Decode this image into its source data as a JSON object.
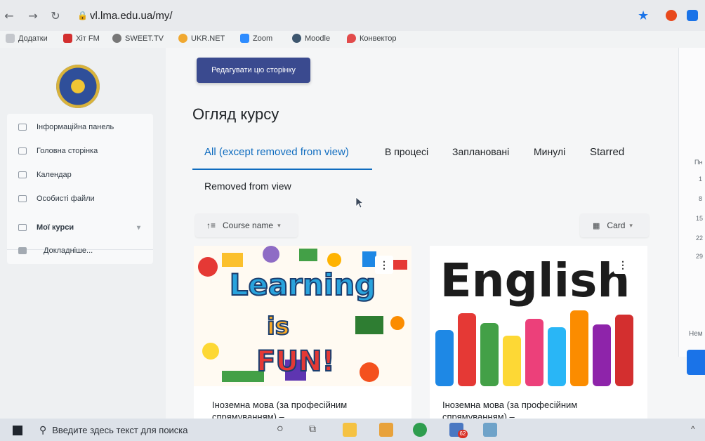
{
  "browser": {
    "url": "vl.lma.edu.ua/my/",
    "bookmarks": [
      "Додатки",
      "Хіт FM",
      "SWEET.TV",
      "UKR.NET",
      "Zoom",
      "Moodle",
      "Конвектор"
    ]
  },
  "sidebar": {
    "items": [
      {
        "label": "Інформаційна панель"
      },
      {
        "label": "Головна сторінка"
      },
      {
        "label": "Календар"
      },
      {
        "label": "Особисті файли"
      },
      {
        "label": "Мої курси"
      },
      {
        "label": "Докладніше..."
      }
    ]
  },
  "main": {
    "edit_button": "Редагувати цю сторінку",
    "heading": "Огляд курсу",
    "tabs": [
      "All (except removed from view)",
      "В процесі",
      "Заплановані",
      "Минулі",
      "Starred",
      "Removed from view"
    ],
    "sort_label": "Course name",
    "view_label": "Card",
    "courses": [
      {
        "title": "Іноземна мова (за професійним спрямуванням) –",
        "image_text": [
          "Learning",
          "is",
          "FUN!"
        ]
      },
      {
        "title": "Іноземна мова (за професійним спрямуванням) –",
        "image_text": [
          "English"
        ]
      }
    ]
  },
  "calendar": {
    "header": "Пн",
    "days": [
      "1",
      "8",
      "15",
      "22",
      "29"
    ],
    "footer": "Нем"
  },
  "taskbar": {
    "search_placeholder": "Введите здесь текст для поиска",
    "badge": "62"
  },
  "colors": {
    "accent_blue": "#0f6cbf",
    "edit_button_bg": "#3a4a8f"
  }
}
